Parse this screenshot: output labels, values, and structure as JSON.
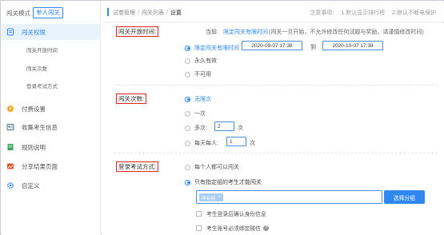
{
  "sidebar": {
    "mode_label": "闯关模式",
    "mode_button": "单人闯关",
    "items": [
      {
        "label": "闯关权限",
        "icon": "document-icon"
      },
      {
        "label": "付费设置",
        "icon": "coin-icon"
      },
      {
        "label": "收集考生信息",
        "icon": "user-list-icon"
      },
      {
        "label": "规则说明",
        "icon": "book-icon"
      },
      {
        "label": "分享结果页面",
        "icon": "share-image-icon"
      },
      {
        "label": "自定义",
        "icon": "gear-icon"
      }
    ],
    "subitems": [
      "闯关开放时间",
      "闯关次数",
      "登录考试方式"
    ]
  },
  "breadcrumb": {
    "items": [
      "试卷管理",
      "闯关列表",
      "设置"
    ]
  },
  "notice": {
    "label": "注意事项:",
    "item1": "1.默认显示排行榜",
    "item2": "2.默认不断电保护"
  },
  "open_time": {
    "label": "闯关开放时间:",
    "current_prefix": "当前:",
    "current_value": "限定闯关有限时间",
    "note": "(闯关一旦开始，不允许修改任何试题与奖励，请谨慎修改时间)",
    "options": [
      "限定闯关有限时间",
      "永久有效",
      "不可用"
    ],
    "start": "2020-09-07 17:38",
    "to": "到",
    "end": "2020-10-07 17:38"
  },
  "attempts": {
    "label": "闯关次数:",
    "options": [
      "无限次",
      "一次",
      "多次:",
      "每天每人:"
    ],
    "multi_value": "2",
    "daily_value": "1",
    "unit": "次"
  },
  "login": {
    "label": "登录考试方式:",
    "options": [
      "每个人都可以闯关",
      "只有指定组的考生才能闯关"
    ],
    "tag": "所有组",
    "select_button": "选择分组",
    "check1": "考生登录后确认身份信息",
    "check2": "考生账号必须绑定微信",
    "help": "?"
  },
  "colors": {
    "accent": "#2f88f0",
    "highlight": "#e02424",
    "active_bg": "#e9f3fe"
  }
}
